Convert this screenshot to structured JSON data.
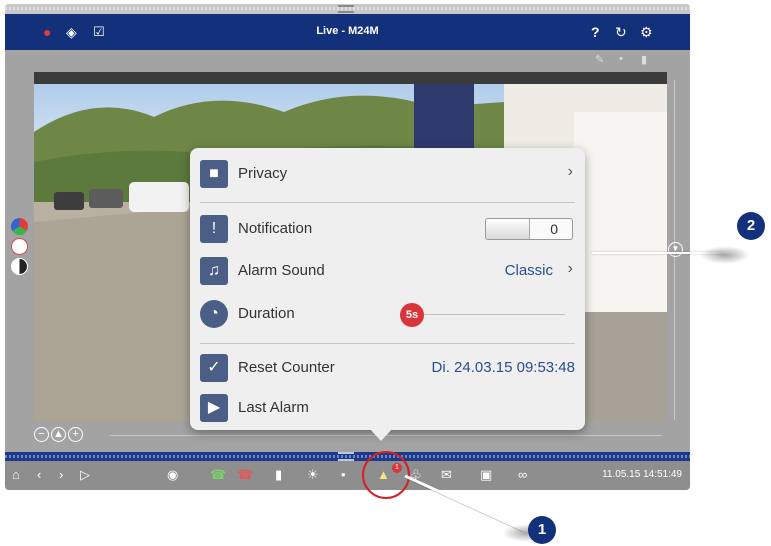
{
  "window": {
    "title": "Live - M24M"
  },
  "popup": {
    "privacy": {
      "label": "Privacy"
    },
    "notification": {
      "label": "Notification",
      "toggle_value": "0"
    },
    "alarm_sound": {
      "label": "Alarm Sound",
      "value": "Classic"
    },
    "duration": {
      "label": "Duration",
      "value": "5s"
    },
    "reset_counter": {
      "label": "Reset Counter",
      "value": "Di. 24.03.15  09:53:48"
    },
    "last_alarm": {
      "label": "Last Alarm"
    }
  },
  "toolbar": {
    "datetime": "11.05.15 14:51:49",
    "alarm_badge": "1"
  },
  "callouts": {
    "one": "1",
    "two": "2"
  },
  "colors": {
    "title_bar": "#13317a",
    "accent_red": "#d9353a",
    "popup_bg": "#efefef"
  },
  "icons": [
    "user-icon",
    "chat-icon",
    "checkbox-icon",
    "help-icon",
    "reload-icon",
    "gear-icon",
    "lock-icon",
    "exclamation-icon",
    "music-note-icon",
    "clock-icon",
    "checkmark-icon",
    "play-icon",
    "home-icon",
    "alarm-bell-icon",
    "mail-icon",
    "camera-icon",
    "link-icon",
    "speaker-icon"
  ]
}
